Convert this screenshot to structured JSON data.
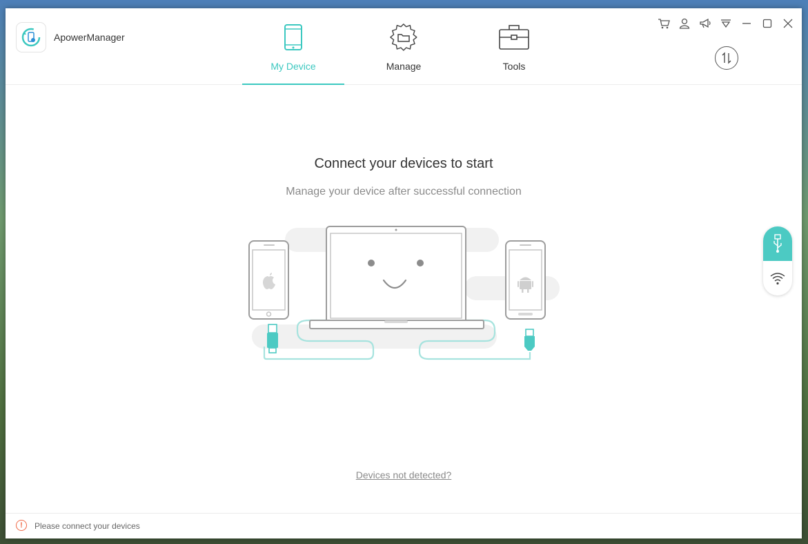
{
  "app": {
    "title": "ApowerManager"
  },
  "tabs": [
    {
      "label": "My Device",
      "icon": "phone-icon",
      "active": true
    },
    {
      "label": "Manage",
      "icon": "gear-folder-icon",
      "active": false
    },
    {
      "label": "Tools",
      "icon": "toolbox-icon",
      "active": false
    }
  ],
  "window_controls": [
    "cart-icon",
    "user-icon",
    "megaphone-icon",
    "menu-icon",
    "minimize-icon",
    "maximize-icon",
    "close-icon"
  ],
  "main": {
    "headline": "Connect your devices to start",
    "subline": "Manage your device after successful connection",
    "help_link": "Devices not detected?"
  },
  "side_panel": {
    "items": [
      "usb-icon",
      "wifi-icon"
    ]
  },
  "status": {
    "text": "Please connect your devices",
    "icon": "warning-circle-icon"
  },
  "colors": {
    "accent": "#3cc8c0",
    "warning": "#f06b4a",
    "text": "#333333",
    "muted": "#8a8a8a"
  }
}
